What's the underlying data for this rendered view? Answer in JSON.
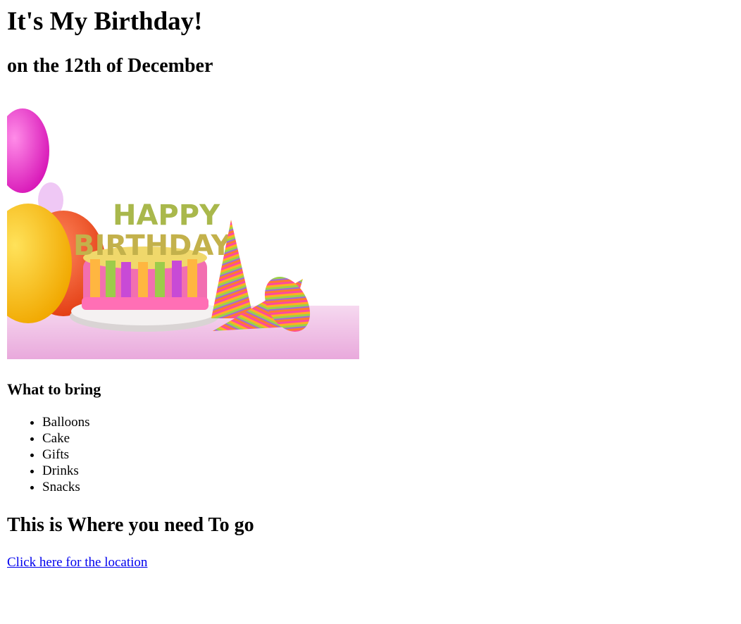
{
  "page": {
    "title": "It's My Birthday!",
    "date": "on the 12th of December"
  },
  "image": {
    "description_icon": "birthday-cake-image",
    "text_on_image": "HAPPY BIRTHDAY"
  },
  "bring": {
    "heading": "What to bring",
    "items": [
      "Balloons",
      "Cake",
      "Gifts",
      "Drinks",
      "Snacks"
    ]
  },
  "location": {
    "heading": "This is Where you need To go",
    "link_text": "Click here for the location",
    "link_color": "#0000ee"
  }
}
